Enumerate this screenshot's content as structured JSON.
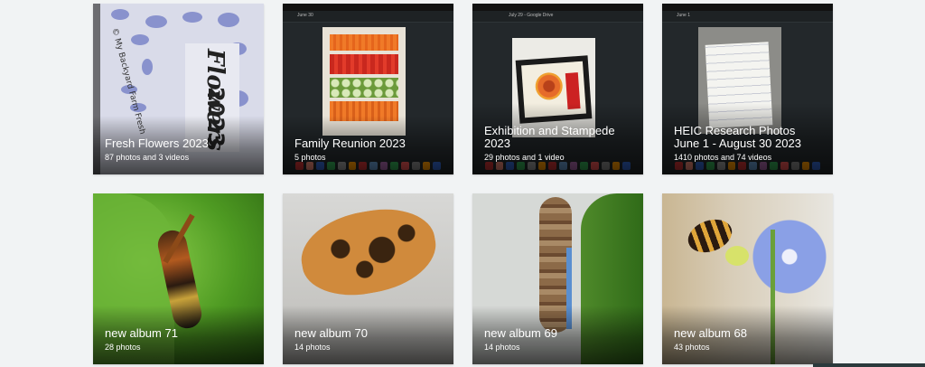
{
  "albums": [
    {
      "title": "Fresh Flowers 2023",
      "subtitle": "87 photos and 3 videos"
    },
    {
      "title": "Family Reunion 2023",
      "subtitle": "5 photos"
    },
    {
      "title": "Exhibition and Stampede 2023",
      "subtitle": "29 photos and 1 video"
    },
    {
      "title": "HEIC Research Photos June 1 - August 30 2023",
      "subtitle": "1410 photos and 74 videos"
    },
    {
      "title": "new album 71",
      "subtitle": "28 photos"
    },
    {
      "title": "new album 70",
      "subtitle": "14 photos"
    },
    {
      "title": "new album 69",
      "subtitle": "14 photos"
    },
    {
      "title": "new album 68",
      "subtitle": "43 photos"
    }
  ],
  "thumbs": {
    "flowers_text_1": "Flowers",
    "flowers_text_2": "2023",
    "flowers_side_text": "© My Backyard Farm Fresh",
    "reunion_date": "June 30",
    "exhibition_tab": "July 29 - Google Drive",
    "heic_date": "June 1"
  }
}
